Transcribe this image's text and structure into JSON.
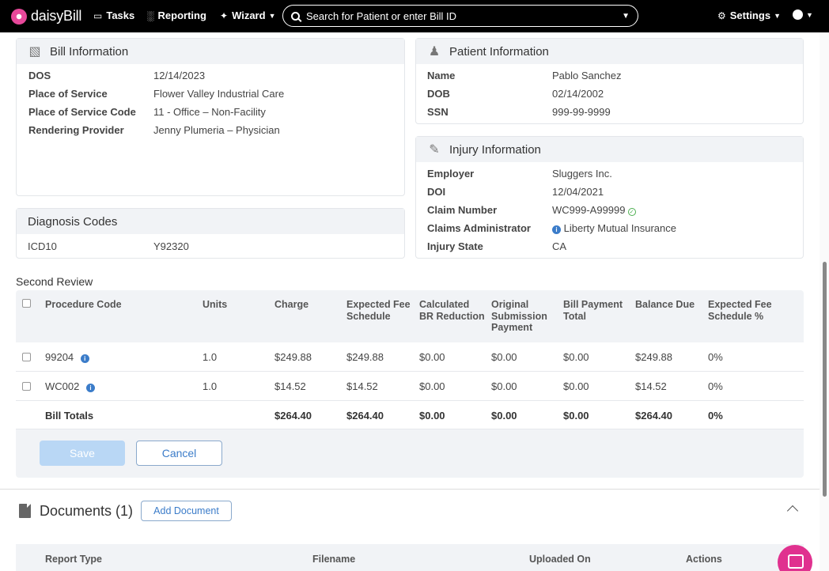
{
  "nav": {
    "logo_text": "daisyBill",
    "tasks": "Tasks",
    "reporting": "Reporting",
    "wizard": "Wizard",
    "search_placeholder": "Search for Patient or enter Bill ID",
    "settings": "Settings"
  },
  "bill_info": {
    "title": "Bill Information",
    "rows": [
      {
        "label": "DOS",
        "value": "12/14/2023"
      },
      {
        "label": "Place of Service",
        "value": "Flower Valley Industrial Care"
      },
      {
        "label": "Place of Service Code",
        "value": "11 - Office – Non-Facility"
      },
      {
        "label": "Rendering Provider",
        "value": "Jenny Plumeria – Physician"
      }
    ]
  },
  "patient_info": {
    "title": "Patient Information",
    "rows": [
      {
        "label": "Name",
        "value": "Pablo Sanchez"
      },
      {
        "label": "DOB",
        "value": "02/14/2002"
      },
      {
        "label": "SSN",
        "value": "999-99-9999"
      }
    ]
  },
  "injury_info": {
    "title": "Injury Information",
    "rows": [
      {
        "label": "Employer",
        "value": "Sluggers Inc."
      },
      {
        "label": "DOI",
        "value": "12/04/2021"
      },
      {
        "label": "Claim Number",
        "value": "WC999-A99999"
      },
      {
        "label": "Claims Administrator",
        "value": "Liberty Mutual Insurance"
      },
      {
        "label": "Injury State",
        "value": "CA"
      }
    ]
  },
  "diagnosis": {
    "title": "Diagnosis Codes",
    "label": "ICD10",
    "value": "Y92320"
  },
  "second_review": {
    "title": "Second Review",
    "headers": [
      "Procedure Code",
      "Units",
      "Charge",
      "Expected Fee\nSchedule",
      "Calculated\nBR Reduction",
      "Original\nSubmission\nPayment",
      "Bill Payment\nTotal",
      "Balance Due",
      "Expected Fee\nSchedule %"
    ],
    "rows": [
      [
        "99204",
        "1.0",
        "$249.88",
        "$249.88",
        "$0.00",
        "$0.00",
        "$0.00",
        "$249.88",
        "0%"
      ],
      [
        "WC002",
        "1.0",
        "$14.52",
        "$14.52",
        "$0.00",
        "$0.00",
        "$0.00",
        "$14.52",
        "0%"
      ]
    ],
    "totals": [
      "Bill Totals",
      "",
      "$264.40",
      "$264.40",
      "$0.00",
      "$0.00",
      "$0.00",
      "$264.40",
      "0%"
    ],
    "save_label": "Save",
    "cancel_label": "Cancel"
  },
  "documents": {
    "title": "Documents (1)",
    "add_label": "Add Document",
    "headers": [
      "Report Type",
      "Filename",
      "Uploaded On",
      "Actions"
    ]
  }
}
